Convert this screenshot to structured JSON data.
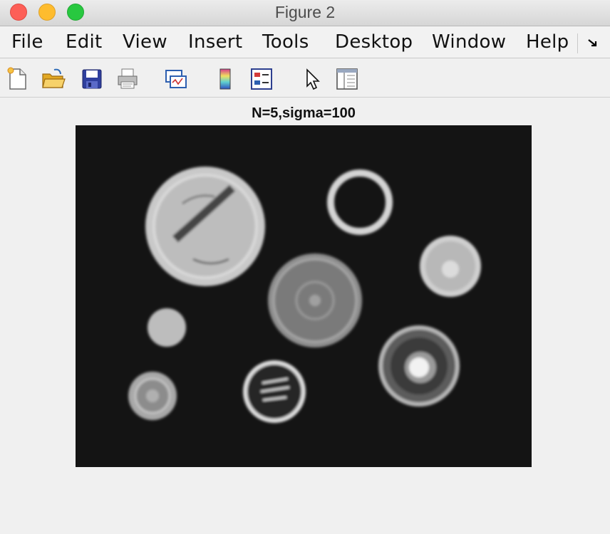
{
  "window": {
    "title": "Figure 2"
  },
  "menu": {
    "items": [
      {
        "label": "File"
      },
      {
        "label": "Edit"
      },
      {
        "label": "View"
      },
      {
        "label": "Insert"
      },
      {
        "label": "Tools"
      },
      {
        "label": "Desktop"
      },
      {
        "label": "Window"
      },
      {
        "label": "Help"
      }
    ]
  },
  "toolbar": {
    "icons": [
      "new-figure-icon",
      "open-file-icon",
      "save-icon",
      "print-icon",
      "link-plot-icon",
      "colorbar-icon",
      "legend-icon",
      "pointer-icon",
      "property-inspector-icon"
    ]
  },
  "plot": {
    "title": "N=5,sigma=100",
    "image_description_colors": {
      "background": "#141414",
      "coin": "#c8c8c8"
    }
  },
  "colors": {
    "close": "#fd5f57",
    "minimize": "#febc2e",
    "maximize": "#28c840"
  }
}
